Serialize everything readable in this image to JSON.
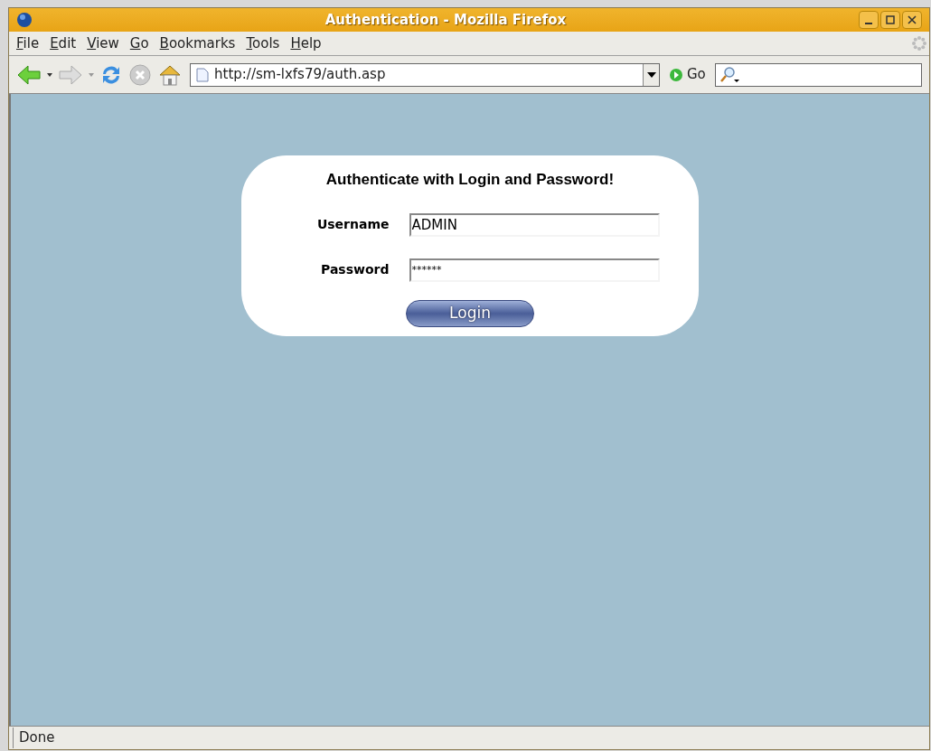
{
  "window": {
    "title": "Authentication - Mozilla Firefox"
  },
  "menu": [
    "File",
    "Edit",
    "View",
    "Go",
    "Bookmarks",
    "Tools",
    "Help"
  ],
  "toolbar": {
    "url": "http://sm-lxfs79/auth.asp",
    "go_label": "Go"
  },
  "form": {
    "heading": "Authenticate with Login and Password!",
    "fields": [
      {
        "label": "Username",
        "value": "ADMIN",
        "kind": "text"
      },
      {
        "label": "Password",
        "value": "******",
        "kind": "password"
      }
    ],
    "button": "Login"
  },
  "status_bar": "Done"
}
